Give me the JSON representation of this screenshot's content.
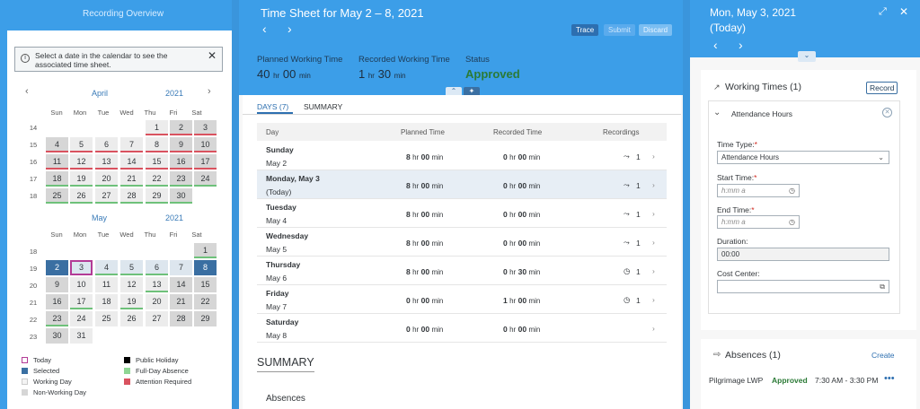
{
  "left": {
    "title": "Recording Overview",
    "info": "Select a date in the calendar to see the associated time sheet.",
    "april": {
      "month": "April",
      "year": "2021"
    },
    "may": {
      "month": "May",
      "year": "2021"
    },
    "dow": [
      "Sun",
      "Mon",
      "Tue",
      "Wed",
      "Thu",
      "Fri",
      "Sat"
    ],
    "april_weeks": [
      "14",
      "15",
      "16",
      "17",
      "18"
    ],
    "may_weeks": [
      "18",
      "19",
      "20",
      "21",
      "22",
      "23"
    ],
    "legend": {
      "today": "Today",
      "selected": "Selected",
      "working_day": "Working Day",
      "non_working_day": "Non-Working Day",
      "public_holiday": "Public Holiday",
      "full_day_absence": "Full-Day Absence",
      "attention_required": "Attention Required"
    },
    "colors": {
      "selected": "#3a6fa2",
      "attention": "#d9525f",
      "absence": "#6ec17a",
      "today": "#b33b96"
    }
  },
  "middle": {
    "title": "Time Sheet for May 2 – 8, 2021",
    "buttons": {
      "trace": "Trace",
      "submit": "Submit",
      "discard": "Discard"
    },
    "planned_label": "Planned Working Time",
    "planned_hr": "40",
    "planned_min": "00",
    "recorded_label": "Recorded Working Time",
    "recorded_hr": "1",
    "recorded_min": "30",
    "status_label": "Status",
    "status_value": "Approved",
    "hr": "hr",
    "min": "min",
    "tabs": {
      "days": "DAYS (7)",
      "summary": "SUMMARY"
    },
    "columns": {
      "day": "Day",
      "planned": "Planned Time",
      "recorded": "Recorded Time",
      "recordings": "Recordings"
    },
    "rows": [
      {
        "day": "Sunday",
        "date": "May 2",
        "planned_hr": "8",
        "planned_min": "00",
        "rec_hr": "0",
        "rec_min": "00",
        "count": "1"
      },
      {
        "day": "Monday, May 3",
        "date": "(Today)",
        "planned_hr": "8",
        "planned_min": "00",
        "rec_hr": "0",
        "rec_min": "00",
        "count": "1"
      },
      {
        "day": "Tuesday",
        "date": "May 4",
        "planned_hr": "8",
        "planned_min": "00",
        "rec_hr": "0",
        "rec_min": "00",
        "count": "1"
      },
      {
        "day": "Wednesday",
        "date": "May 5",
        "planned_hr": "8",
        "planned_min": "00",
        "rec_hr": "0",
        "rec_min": "00",
        "count": "1"
      },
      {
        "day": "Thursday",
        "date": "May 6",
        "planned_hr": "8",
        "planned_min": "00",
        "rec_hr": "0",
        "rec_min": "30",
        "count": "1"
      },
      {
        "day": "Friday",
        "date": "May 7",
        "planned_hr": "0",
        "planned_min": "00",
        "rec_hr": "1",
        "rec_min": "00",
        "count": "1"
      },
      {
        "day": "Saturday",
        "date": "May 8",
        "planned_hr": "0",
        "planned_min": "00",
        "rec_hr": "0",
        "rec_min": "00",
        "count": ""
      }
    ],
    "summary_heading": "SUMMARY",
    "absences_heading": "Absences"
  },
  "right": {
    "date": "Mon, May 3, 2021",
    "today": "(Today)",
    "working_times": "Working Times (1)",
    "record_button": "Record",
    "attendance": "Attendance Hours",
    "time_type_label": "Time Type:",
    "time_type_value": "Attendance Hours",
    "start_label": "Start Time:",
    "start_placeholder": "h:mm a",
    "end_label": "End Time:",
    "end_placeholder": "h:mm a",
    "duration_label": "Duration:",
    "duration_value": "00:00",
    "cost_center_label": "Cost Center:",
    "absences": "Absences (1)",
    "create": "Create",
    "absence_name": "Pilgrimage LWP",
    "absence_status": "Approved",
    "absence_time": "7:30 AM - 3:30 PM"
  }
}
